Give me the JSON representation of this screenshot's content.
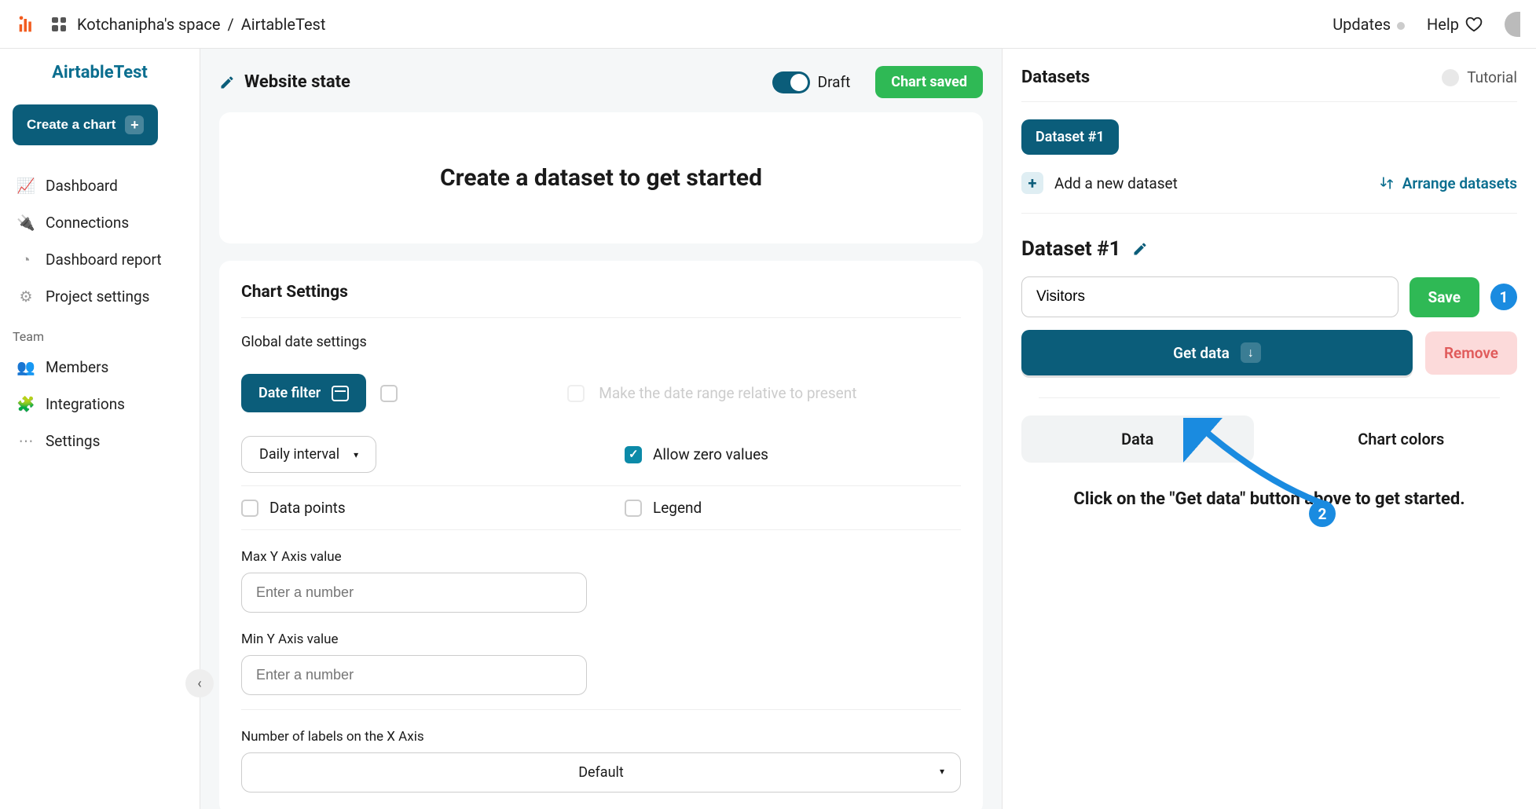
{
  "breadcrumb": {
    "workspace": "Kotchanipha's space",
    "project": "AirtableTest"
  },
  "topnav": {
    "updates": "Updates",
    "help": "Help"
  },
  "sidebar": {
    "title": "AirtableTest",
    "create": "Create a chart",
    "items": {
      "dashboard": "Dashboard",
      "connections": "Connections",
      "report": "Dashboard report",
      "project_settings": "Project settings"
    },
    "team_label": "Team",
    "team": {
      "members": "Members",
      "integrations": "Integrations",
      "settings": "Settings"
    }
  },
  "main": {
    "state_title": "Website state",
    "draft": "Draft",
    "chart_saved": "Chart saved",
    "hero": "Create a dataset to get started",
    "chart_settings": "Chart Settings",
    "global_date": "Global date settings",
    "date_filter": "Date filter",
    "relative_label": "Make the date range relative to present",
    "interval": "Daily interval",
    "allow_zero": "Allow zero values",
    "data_points": "Data points",
    "legend": "Legend",
    "max_y": "Max Y Axis value",
    "min_y": "Min Y Axis value",
    "num_placeholder": "Enter a number",
    "xaxis_labels": "Number of labels on the X Axis",
    "xaxis_default": "Default"
  },
  "right": {
    "datasets": "Datasets",
    "tutorial": "Tutorial",
    "chip": "Dataset #1",
    "add_new": "Add a new dataset",
    "arrange": "Arrange datasets",
    "ds_title": "Dataset #1",
    "input_value": "Visitors",
    "save": "Save",
    "get_data": "Get data",
    "remove": "Remove",
    "tab_data": "Data",
    "tab_colors": "Chart colors",
    "hint": "Click on the \"Get data\" button above to get started.",
    "badge1": "1",
    "badge2": "2"
  }
}
